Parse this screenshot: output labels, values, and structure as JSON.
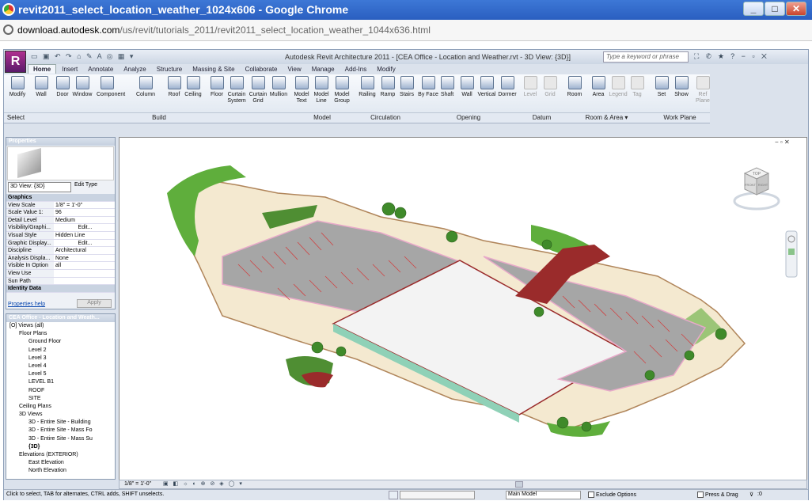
{
  "browser": {
    "window_title": "revit2011_select_location_weather_1024x606 - Google Chrome",
    "url_host": "download.autodesk.com",
    "url_path": "/us/revit/tutorials_2011/revit2011_select_location_weather_1044x636.html",
    "controls": {
      "minimize": "_",
      "maximize": "□",
      "close": "✕"
    }
  },
  "revit": {
    "logo": "R",
    "title": "Autodesk Revit Architecture 2011 - [CEA Office - Location and Weather.rvt - 3D View: {3D}]",
    "search_placeholder": "Type a keyword or phrase",
    "tabs": [
      "Home",
      "Insert",
      "Annotate",
      "Analyze",
      "Structure",
      "Massing & Site",
      "Collaborate",
      "View",
      "Manage",
      "Add-Ins",
      "Modify"
    ],
    "active_tab": "Home",
    "ribbon_buttons": [
      {
        "label": "Modify",
        "panel": "Select",
        "disabled": false
      },
      {
        "label": "Wall",
        "panel": "Build",
        "disabled": false
      },
      {
        "label": "Door",
        "panel": "Build",
        "disabled": false
      },
      {
        "label": "Window",
        "panel": "Build",
        "disabled": false
      },
      {
        "label": "Component",
        "panel": "Build",
        "disabled": false
      },
      {
        "label": "Column",
        "panel": "Build",
        "disabled": false
      },
      {
        "label": "Roof",
        "panel": "Build",
        "disabled": false
      },
      {
        "label": "Ceiling",
        "panel": "Build",
        "disabled": false
      },
      {
        "label": "Floor",
        "panel": "Build",
        "disabled": false
      },
      {
        "label": "Curtain System",
        "panel": "Build",
        "disabled": false
      },
      {
        "label": "Curtain Grid",
        "panel": "Build",
        "disabled": false
      },
      {
        "label": "Mullion",
        "panel": "Build",
        "disabled": false
      },
      {
        "label": "Model Text",
        "panel": "Model",
        "disabled": false
      },
      {
        "label": "Model Line",
        "panel": "Model",
        "disabled": false
      },
      {
        "label": "Model Group",
        "panel": "Model",
        "disabled": false
      },
      {
        "label": "Railing",
        "panel": "Circulation",
        "disabled": false
      },
      {
        "label": "Ramp",
        "panel": "Circulation",
        "disabled": false
      },
      {
        "label": "Stairs",
        "panel": "Circulation",
        "disabled": false
      },
      {
        "label": "By Face",
        "panel": "Opening",
        "disabled": false
      },
      {
        "label": "Shaft",
        "panel": "Opening",
        "disabled": false
      },
      {
        "label": "Wall",
        "panel": "Opening",
        "disabled": false
      },
      {
        "label": "Vertical",
        "panel": "Opening",
        "disabled": false
      },
      {
        "label": "Dormer",
        "panel": "Opening",
        "disabled": false
      },
      {
        "label": "Level",
        "panel": "Datum",
        "disabled": true
      },
      {
        "label": "Grid",
        "panel": "Datum",
        "disabled": true
      },
      {
        "label": "Room",
        "panel": "Room & Area",
        "disabled": false
      },
      {
        "label": "Area",
        "panel": "Room & Area",
        "disabled": false
      },
      {
        "label": "Legend",
        "panel": "Room & Area",
        "disabled": true
      },
      {
        "label": "Tag",
        "panel": "Room & Area",
        "disabled": true
      },
      {
        "label": "Set",
        "panel": "Work Plane",
        "disabled": false
      },
      {
        "label": "Show",
        "panel": "Work Plane",
        "disabled": false
      },
      {
        "label": "Ref Plane",
        "panel": "Work Plane",
        "disabled": true
      }
    ],
    "panels": [
      "Select",
      "Build",
      "Model",
      "Circulation",
      "Opening",
      "Datum",
      "Room & Area ▾",
      "Work Plane"
    ],
    "properties": {
      "header": "Properties",
      "type_selector": "3D View: {3D}",
      "edit_type": "Edit Type",
      "rows": [
        {
          "k": "Graphics",
          "v": "",
          "section": true
        },
        {
          "k": "View Scale",
          "v": "1/8\" = 1'-0\""
        },
        {
          "k": "Scale Value    1:",
          "v": "96"
        },
        {
          "k": "Detail Level",
          "v": "Medium"
        },
        {
          "k": "Visibility/Graphi...",
          "v": "Edit..."
        },
        {
          "k": "Visual Style",
          "v": "Hidden Line"
        },
        {
          "k": "Graphic Display...",
          "v": "Edit..."
        },
        {
          "k": "Discipline",
          "v": "Architectural"
        },
        {
          "k": "Analysis Displa...",
          "v": "None"
        },
        {
          "k": "Visible In Option",
          "v": "all"
        },
        {
          "k": "View Use",
          "v": ""
        },
        {
          "k": "Sun Path",
          "v": ""
        },
        {
          "k": "Identity Data",
          "v": "",
          "section": true
        }
      ],
      "help": "Properties help",
      "apply": "Apply"
    },
    "project_browser": {
      "header": "CEA Office - Location and Weath...",
      "nodes": [
        {
          "t": "[O] Views (all)",
          "d": 0,
          "b": false
        },
        {
          "t": "Floor Plans",
          "d": 1,
          "b": false
        },
        {
          "t": "Ground Floor",
          "d": 2,
          "b": false
        },
        {
          "t": "Level 2",
          "d": 2,
          "b": false
        },
        {
          "t": "Level 3",
          "d": 2,
          "b": false
        },
        {
          "t": "Level 4",
          "d": 2,
          "b": false
        },
        {
          "t": "Level 5",
          "d": 2,
          "b": false
        },
        {
          "t": "LEVEL B1",
          "d": 2,
          "b": false
        },
        {
          "t": "ROOF",
          "d": 2,
          "b": false
        },
        {
          "t": "SITE",
          "d": 2,
          "b": false
        },
        {
          "t": "Ceiling Plans",
          "d": 1,
          "b": false
        },
        {
          "t": "3D Views",
          "d": 1,
          "b": false
        },
        {
          "t": "3D - Entire Site - Building",
          "d": 2,
          "b": false
        },
        {
          "t": "3D - Entire Site - Mass Fo",
          "d": 2,
          "b": false
        },
        {
          "t": "3D - Entire Site - Mass Su",
          "d": 2,
          "b": false
        },
        {
          "t": "{3D}",
          "d": 2,
          "b": true
        },
        {
          "t": "Elevations (EXTERIOR)",
          "d": 1,
          "b": false
        },
        {
          "t": "East Elevation",
          "d": 2,
          "b": false
        },
        {
          "t": "North Elevation",
          "d": 2,
          "b": false
        }
      ]
    },
    "view_control_scale": "1/8\" = 1'-0\"",
    "status_text": "Click to select, TAB for alternates, CTRL adds, SHIFT unselects.",
    "workset": "Main Model",
    "exclude_options": "Exclude Options",
    "press_drag": "Press & Drag",
    "filter_count": ":0",
    "viewcube_faces": {
      "top": "TOP",
      "front": "FRONT",
      "right": "RIGHT"
    }
  },
  "colors": {
    "chrome_title": "#2d65c8",
    "parking": "#a6a6a6",
    "grass": "#5fae3c",
    "brick": "#9a2b2b",
    "site_edge": "#e8a9c9"
  }
}
